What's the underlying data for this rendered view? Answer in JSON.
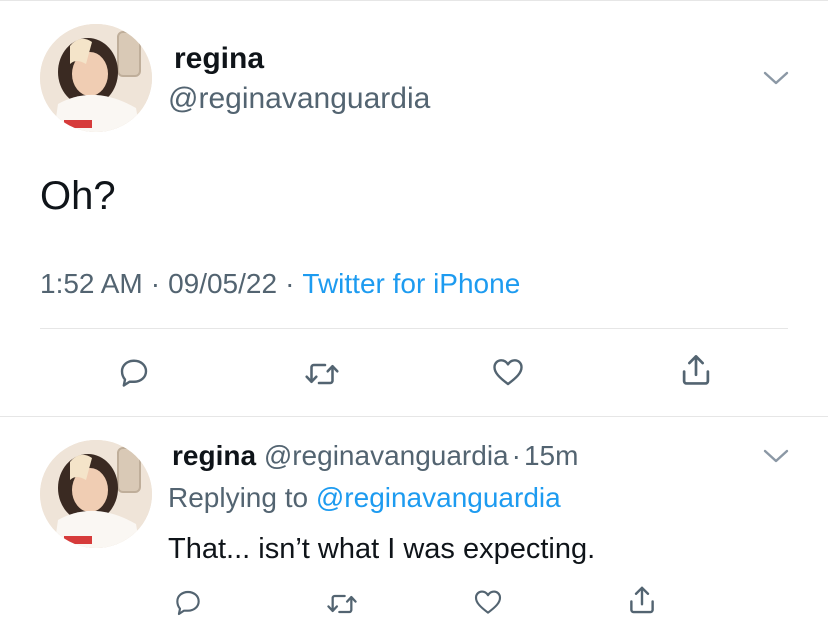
{
  "main_tweet": {
    "display_name": "regina",
    "handle": "@reginavanguardia",
    "text": "Oh?",
    "time": "1:52 AM",
    "date": "09/05/22",
    "source": "Twitter for iPhone",
    "meta_separator": "·"
  },
  "reply_tweet": {
    "display_name": "regina",
    "handle": "@reginavanguardia",
    "separator": "·",
    "age": "15m",
    "replying_to_label": "Replying to",
    "replying_to_handle": "@reginavanguardia",
    "text": "That... isn’t what I was expecting."
  },
  "icons": {
    "reply": "reply-icon",
    "retweet": "retweet-icon",
    "like": "heart-icon",
    "share": "share-icon",
    "more": "chevron-down-icon"
  },
  "colors": {
    "text": "#0f1419",
    "secondary": "#536471",
    "link": "#1d9bf0",
    "icon": "#536471",
    "divider": "#e6e6e6"
  }
}
